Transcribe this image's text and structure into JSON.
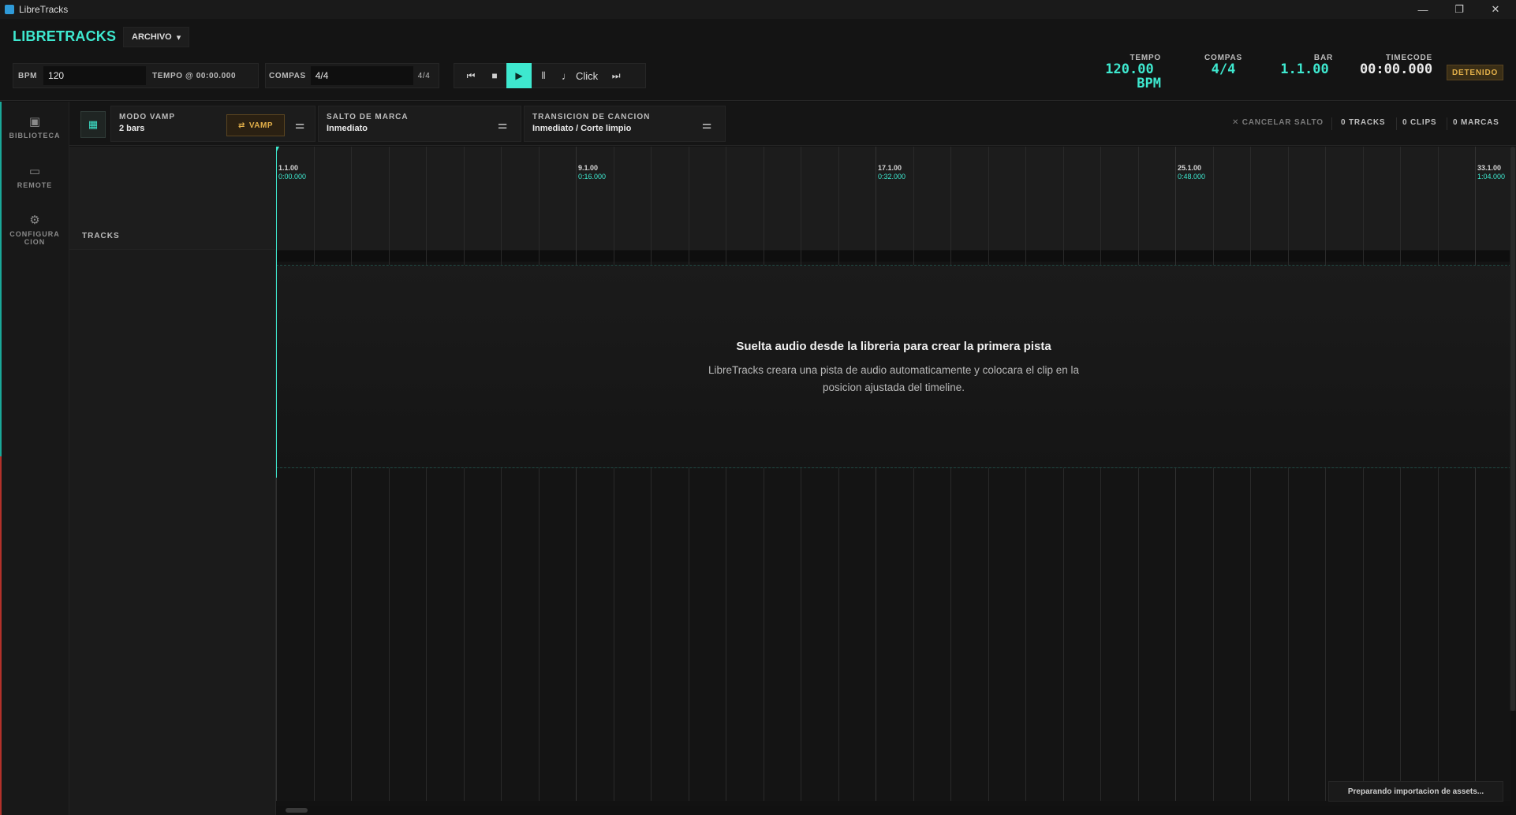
{
  "window": {
    "title": "LibreTracks",
    "minimize": "—",
    "maximize": "❐",
    "close": "✕"
  },
  "header": {
    "brand": "LIBRETRACKS",
    "menu": {
      "label": "ARCHIVO",
      "caret": "▾"
    },
    "bpm": {
      "label": "BPM",
      "value": "120"
    },
    "tempo_at": {
      "label": "TEMPO @ 00:00.000"
    },
    "compas": {
      "label": "COMPAS",
      "value": "4/4",
      "suffix": "4/4"
    },
    "transport": {
      "prev": "⏮",
      "stop": "■",
      "play": "▶",
      "pause": "⦀",
      "click_icon": "♩",
      "click_label": "Click",
      "next": "⏭"
    },
    "stats": {
      "tempo": {
        "label": "TEMPO",
        "value": "120.00",
        "unit": "BPM"
      },
      "compas": {
        "label": "COMPAS",
        "value": "4/4"
      },
      "bar": {
        "label": "BAR",
        "value": "1.1.00"
      },
      "timecode": {
        "label": "TIMECODE",
        "value": "00:00.000"
      }
    },
    "state_badge": "DETENIDO"
  },
  "sidebar": {
    "items": [
      {
        "label": "BIBLIOTECA",
        "icon": "library-icon"
      },
      {
        "label": "REMOTE",
        "icon": "remote-icon"
      },
      {
        "label": "CONFIGURA",
        "label2": "CION",
        "icon": "gear-icon"
      }
    ]
  },
  "toolbar": {
    "vamp": {
      "label": "MODO VAMP",
      "value": "2 bars",
      "button": "VAMP"
    },
    "marker_jump": {
      "label": "SALTO DE MARCA",
      "value": "Inmediato"
    },
    "song_transition": {
      "label": "TRANSICION DE CANCION",
      "value": "Inmediato / Corte limpio"
    },
    "cancel_jump": "CANCELAR SALTO",
    "counts": {
      "tracks": "0 TRACKS",
      "clips": "0 CLIPS",
      "marks": "0 MARCAS"
    }
  },
  "tracks_header": "TRACKS",
  "timeline": {
    "markers": [
      {
        "bar": "1.1.00",
        "time": "0:00.000"
      },
      {
        "bar": "9.1.00",
        "time": "0:16.000"
      },
      {
        "bar": "17.1.00",
        "time": "0:32.000"
      },
      {
        "bar": "25.1.00",
        "time": "0:48.000"
      },
      {
        "bar": "33.1.00",
        "time": "1:04.000"
      }
    ],
    "empty_title": "Suelta audio desde la libreria para crear la primera pista",
    "empty_desc": "LibreTracks creara una pista de audio automaticamente y colocara el clip en la posicion ajustada del timeline."
  },
  "status": "Preparando importacion de assets...",
  "colors": {
    "accent": "#3ee8cf",
    "warning": "#e3b04a",
    "background": "#141414"
  }
}
